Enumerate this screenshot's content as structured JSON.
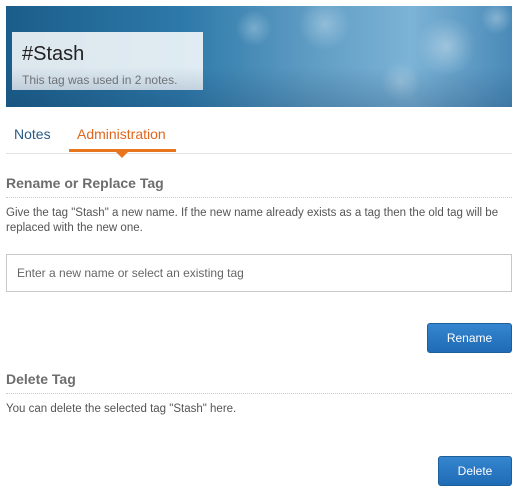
{
  "header": {
    "title": "#Stash",
    "subtitle": "This tag was used in 2 notes."
  },
  "tabs": [
    {
      "label": "Notes",
      "active": false
    },
    {
      "label": "Administration",
      "active": true
    }
  ],
  "rename": {
    "heading": "Rename or Replace Tag",
    "description": "Give the tag \"Stash\" a new name. If the new name already exists as a tag then the old tag will be replaced with the new one.",
    "input_placeholder": "Enter a new name or select an existing tag",
    "input_value": "",
    "button_label": "Rename"
  },
  "delete": {
    "heading": "Delete Tag",
    "description": "You can delete the selected tag \"Stash\" here.",
    "button_label": "Delete"
  },
  "colors": {
    "accent": "#e8761e",
    "link": "#2b5b84",
    "button": "#1f6bb6"
  }
}
